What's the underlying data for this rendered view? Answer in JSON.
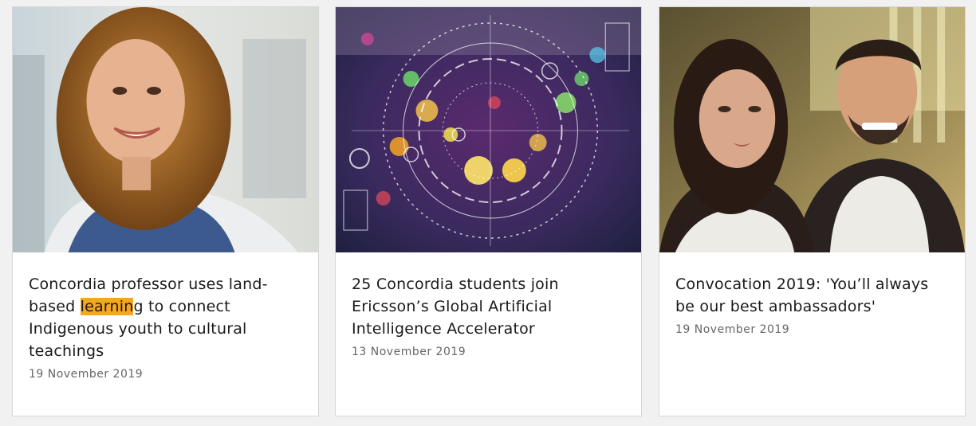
{
  "cards": [
    {
      "image_alt": "Portrait of a smiling woman with curly hair",
      "title_before": "Concordia professor uses land-based ",
      "title_highlight": "learnin",
      "title_after": "g to connect Indigenous youth to cultural teachings",
      "date": "19 November 2019"
    },
    {
      "image_alt": "Futuristic digital interface over city lights",
      "title": "25 Concordia students join Ericsson’s Global Artificial Intelligence Accelerator",
      "date": "13 November 2019"
    },
    {
      "image_alt": "Two graduates in convocation gowns",
      "title": "Convocation 2019: 'You’ll always be our best ambassadors'",
      "date": "19 November 2019"
    }
  ],
  "colors": {
    "highlight": "#f5a623",
    "title_text": "#1a1a1a",
    "date_text": "#666666"
  },
  "icons": [
    "hud-circle-icon"
  ]
}
